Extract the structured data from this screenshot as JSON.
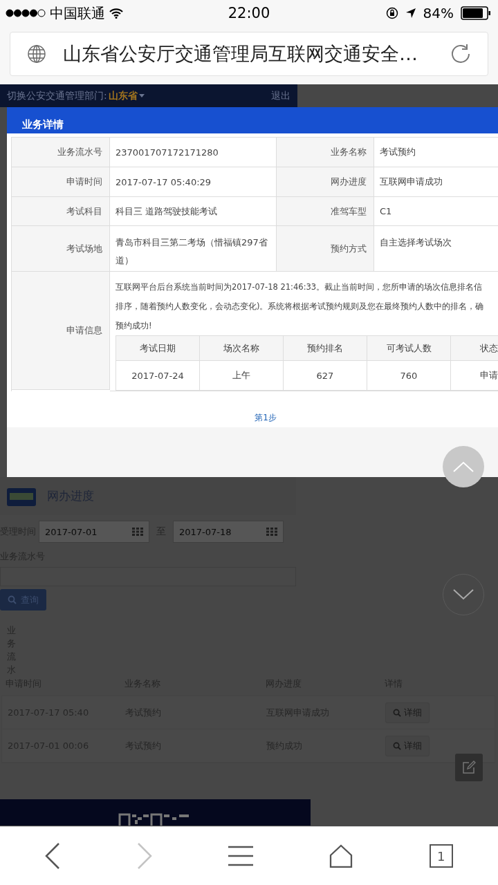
{
  "status_bar": {
    "carrier": "中国联通",
    "time": "22:00",
    "battery": "84%"
  },
  "address_bar": {
    "title": "山东省公安厅交通管理局互联网交通安全…"
  },
  "page_header": {
    "label": "切换公安交通管理部门:",
    "province": "山东省",
    "logout": "退出"
  },
  "modal": {
    "title": "业务详情",
    "details": [
      {
        "label": "业务流水号",
        "value": "237001707172171280",
        "label_2": "业务名称",
        "value_2": "考试预约"
      },
      {
        "label": "申请时间",
        "value": "2017-07-17 05:40:29",
        "label_2": "网办进度",
        "value_2": "互联网申请成功"
      },
      {
        "label": "考试科目",
        "value": "科目三 道路驾驶技能考试",
        "label_2": "准驾车型",
        "value_2": "C1"
      },
      {
        "label": "考试场地",
        "value": "青岛市科目三第二考场（惜福镇297省道）",
        "label_2": "预约方式",
        "value_2": "自主选择考试场次"
      }
    ],
    "info_label": "申请信息",
    "info_lines": [
      "互联网平台后台系统当前时间为2017-07-18 21:46:33。截止当前时间，您所申请的场次信息排名信",
      "排序，随着预约人数变化，会动态变化)。系统将根据考试预约规则及您在最终预约人数中的排名，确",
      "预约成功!"
    ],
    "sessions": {
      "columns": [
        "考试日期",
        "场次名称",
        "预约排名",
        "可考试人数",
        "状态"
      ],
      "rows": [
        [
          "2017-07-24",
          "上午",
          "627",
          "760",
          "申请"
        ]
      ]
    },
    "step": "第1步"
  },
  "progress": {
    "title": "网办进度",
    "date_label": "受理时间",
    "date_from": "2017-07-01",
    "to": "至",
    "date_to": "2017-07-18",
    "serial_label": "业务流水号",
    "search_button": "查询",
    "vertical_label": "业务流水",
    "columns": [
      "申请时间",
      "业务名称",
      "网办进度",
      "详情"
    ],
    "rows": [
      {
        "time": "2017-07-17 05:40",
        "name": "考试预约",
        "progress": "互联网申请成功",
        "detail": "详细"
      },
      {
        "time": "2017-07-01 00:06",
        "name": "考试预约",
        "progress": "预约成功",
        "detail": "详细"
      }
    ]
  },
  "toolbar": {
    "tab_count": "1",
    "buttons": [
      {
        "kind": "back",
        "disabled": false
      },
      {
        "kind": "forward",
        "disabled": true
      },
      {
        "kind": "menu",
        "disabled": false
      },
      {
        "kind": "home",
        "disabled": false
      },
      {
        "kind": "tabs",
        "disabled": false
      }
    ]
  }
}
